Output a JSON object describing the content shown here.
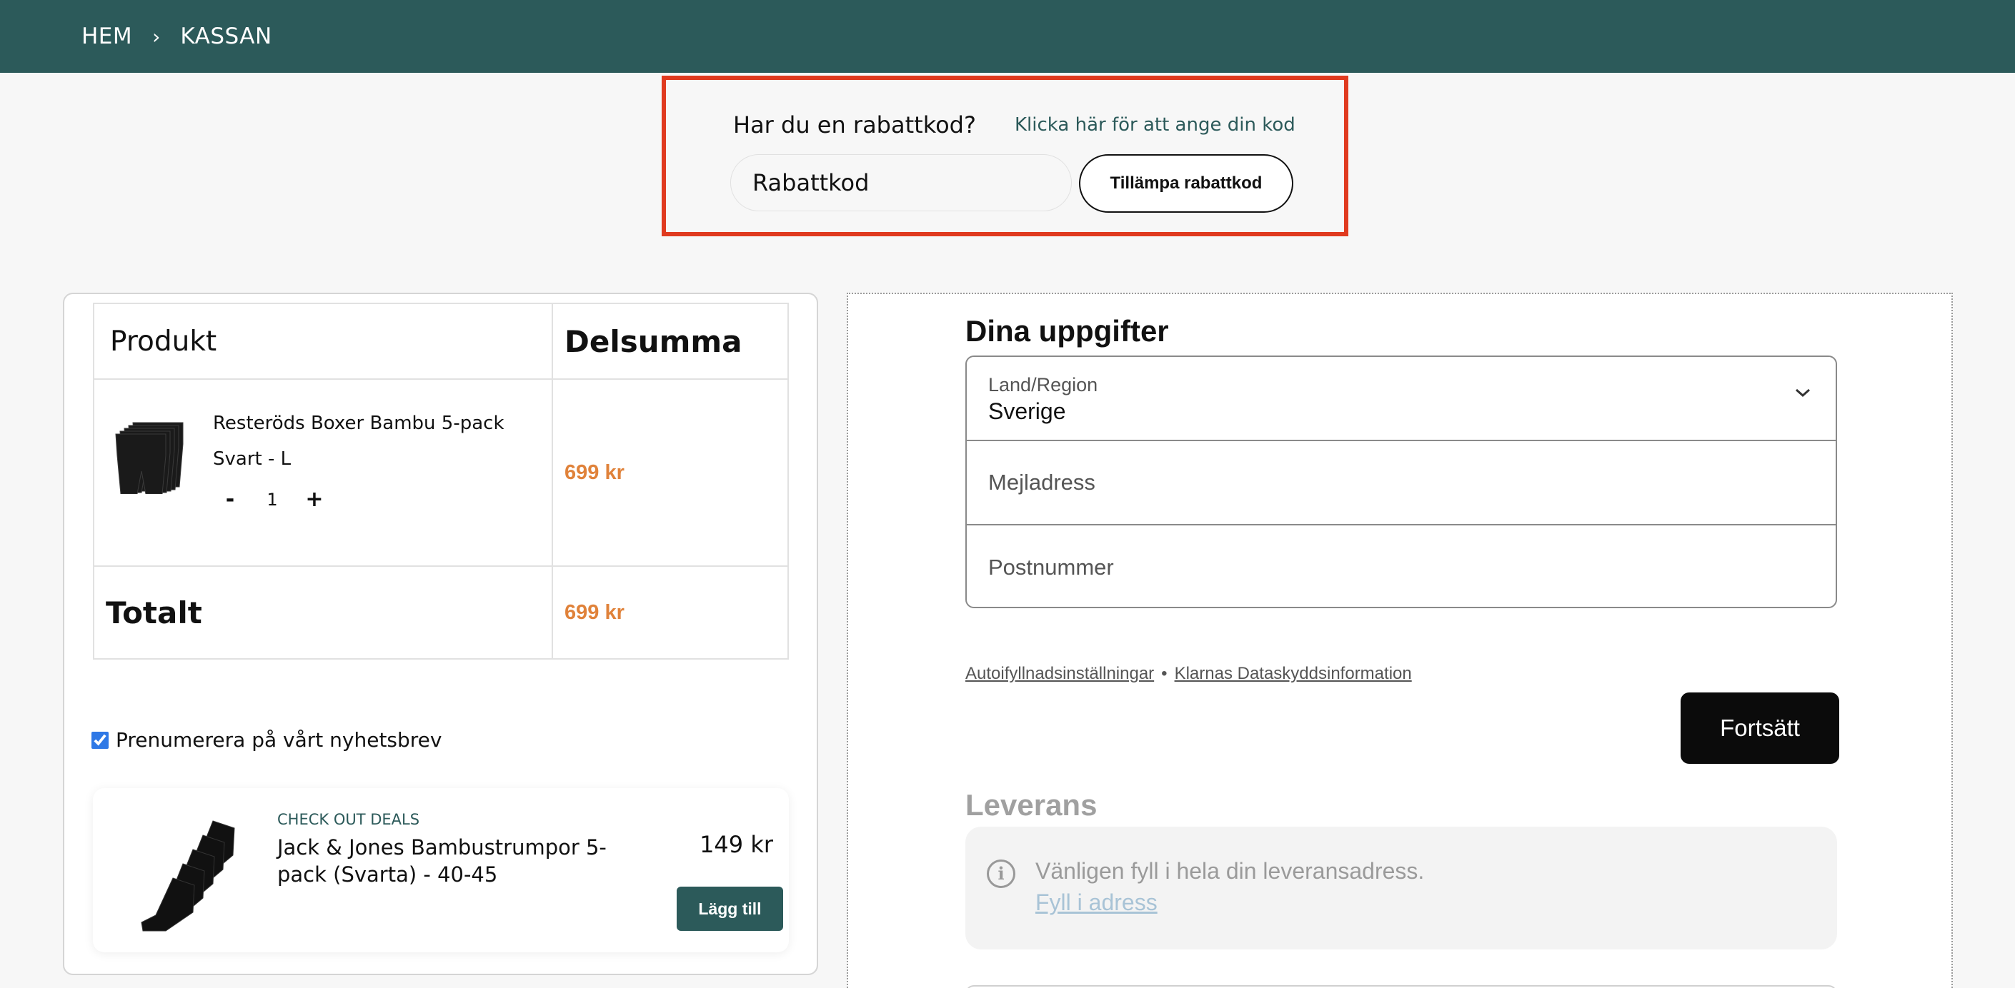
{
  "breadcrumb": {
    "home": "HEM",
    "separator": "›",
    "current": "KASSAN"
  },
  "coupon": {
    "question": "Har du en rabattkod?",
    "link": "Klicka här för att ange din kod",
    "input_placeholder": "Rabattkod",
    "apply_label": "Tillämpa rabattkod"
  },
  "order": {
    "col_product": "Produkt",
    "col_subtotal": "Delsumma",
    "item": {
      "name": "Resteröds Boxer Bambu 5-pack Svart - L",
      "minus": "-",
      "quantity": "1",
      "plus": "+",
      "subtotal": "699 kr"
    },
    "total_label": "Totalt",
    "total_value": "699 kr"
  },
  "newsletter": {
    "label": "Prenumerera på vårt nyhetsbrev",
    "checked": true
  },
  "deal": {
    "tag": "CHECK OUT DEALS",
    "name": "Jack & Jones Bambustrumpor 5-pack (Svarta) - 40-45",
    "price": "149 kr",
    "add_label": "Lägg till"
  },
  "checkout": {
    "title": "Dina uppgifter",
    "country_label": "Land/Region",
    "country_value": "Sverige",
    "email_placeholder": "Mejladress",
    "zip_placeholder": "Postnummer",
    "autofill_link": "Autoifyllnadsinställningar",
    "dot": "•",
    "privacy_link": "Klarnas Dataskyddsinformation",
    "continue_label": "Fortsätt",
    "delivery_title": "Leverans",
    "delivery_info": "Vänligen fyll i hela din leveransadress.",
    "delivery_link": "Fyll i adress"
  },
  "colors": {
    "header": "#2c5a5a",
    "highlight_border": "#e03a1f",
    "price": "#e0823a",
    "button_dark": "#0b0b0b"
  },
  "icons": {
    "chevron": "chevron-down-icon",
    "info": "info-icon",
    "separator": "chevron-right-icon"
  }
}
